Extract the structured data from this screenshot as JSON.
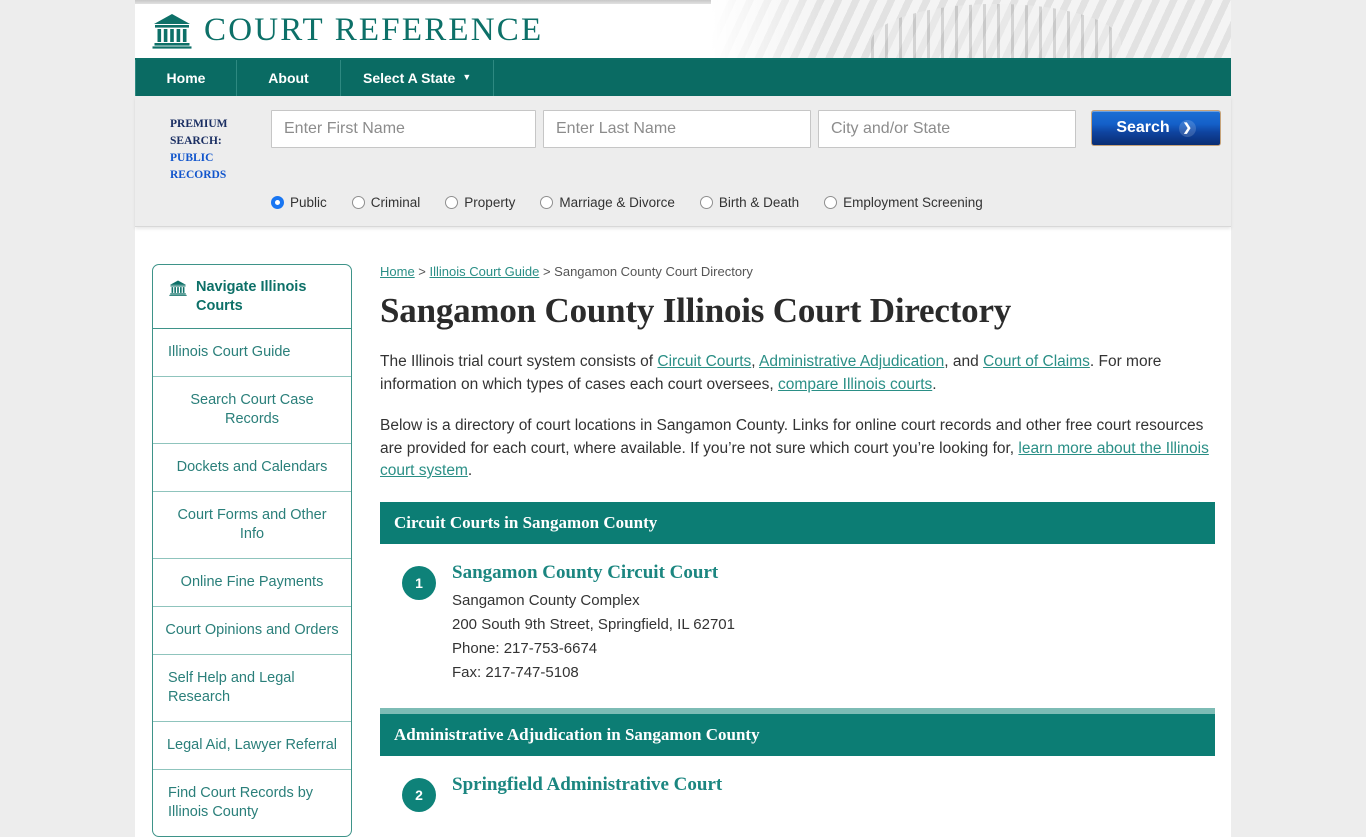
{
  "brand": {
    "name": "COURT REFERENCE",
    "icon": "bank-building-icon",
    "teal": "#0d7068"
  },
  "nav": {
    "items": [
      {
        "label": "Home"
      },
      {
        "label": "About"
      },
      {
        "label": "Select A State",
        "caret": "▼"
      }
    ]
  },
  "search": {
    "premium_line1": "PREMIUM SEARCH:",
    "premium_line2": "PUBLIC RECORDS",
    "first_name_placeholder": "Enter First Name",
    "first_name_value": "",
    "last_name_placeholder": "Enter Last Name",
    "last_name_value": "",
    "city_state_placeholder": "City and/or State",
    "city_state_value": "",
    "button_label": "Search",
    "button_chevron": "❯",
    "radios": [
      {
        "label": "Public",
        "selected": true
      },
      {
        "label": "Criminal",
        "selected": false
      },
      {
        "label": "Property",
        "selected": false
      },
      {
        "label": "Marriage & Divorce",
        "selected": false
      },
      {
        "label": "Birth & Death",
        "selected": false
      },
      {
        "label": "Employment Screening",
        "selected": false
      }
    ]
  },
  "sidebar": {
    "header": "Navigate Illinois Courts",
    "header_icon": "bank-building-icon",
    "items": [
      {
        "label": "Illinois Court Guide"
      },
      {
        "label": "Search Court Case Records"
      },
      {
        "label": "Dockets and Calendars"
      },
      {
        "label": "Court Forms and Other Info"
      },
      {
        "label": "Online Fine Payments"
      },
      {
        "label": "Court Opinions and Orders"
      },
      {
        "label": "Self Help and Legal Research"
      },
      {
        "label": "Legal Aid, Lawyer Referral"
      },
      {
        "label": "Find Court Records by Illinois County"
      }
    ]
  },
  "breadcrumb": {
    "home": "Home",
    "sep1": " > ",
    "guide": "Illinois Court Guide",
    "sep2": " > ",
    "current": "Sangamon County Court Directory"
  },
  "main": {
    "title": "Sangamon County Illinois Court Directory",
    "para1": {
      "t1": "The Illinois trial court system consists of ",
      "l1": "Circuit Courts",
      "t2": ", ",
      "l2": "Administrative Adjudication",
      "t3": ", and ",
      "l3": "Court of Claims",
      "t4": ". For more information on which types of cases each court oversees, ",
      "l4": "compare Illinois courts",
      "t5": "."
    },
    "para2": {
      "t1": "Below is a directory of court locations in Sangamon County. Links for online court records and other free court resources are provided for each court, where available. If you’re not sure which court you’re looking for, ",
      "l1": "learn more about the Illinois court system",
      "t2": "."
    },
    "sections": [
      {
        "heading": "Circuit Courts in Sangamon County",
        "courts": [
          {
            "number": "1",
            "name": "Sangamon County Circuit Court",
            "lines": [
              "Sangamon County Complex",
              "200 South 9th Street, Springfield, IL 62701",
              "Phone: 217-753-6674",
              "Fax: 217-747-5108"
            ]
          }
        ]
      },
      {
        "heading": "Administrative Adjudication in Sangamon County",
        "courts": [
          {
            "number": "2",
            "name": "Springfield Administrative Court",
            "lines": []
          }
        ]
      }
    ]
  }
}
